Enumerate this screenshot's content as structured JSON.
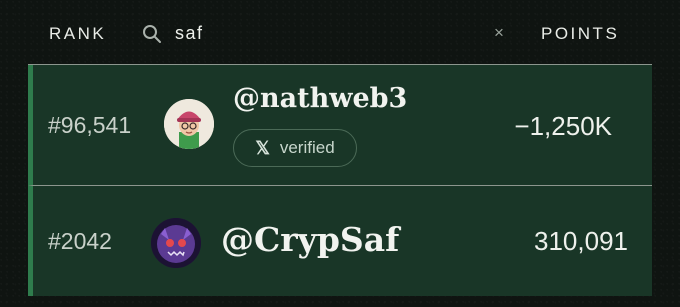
{
  "header": {
    "rank_label": "RANK",
    "search_value": "saf",
    "clear_symbol": "×",
    "points_label": "POINTS"
  },
  "rows": [
    {
      "rank": "#96,541",
      "handle": "@nathweb3",
      "badge": {
        "icon": "x-logo-icon",
        "symbol": "𝕏",
        "label": "verified"
      },
      "points": "−1,250K",
      "avatar": "avatar-pink-beanie"
    },
    {
      "rank": "#2042",
      "handle": "@CrypSaf",
      "points": "310,091",
      "avatar": "avatar-purple-creature"
    }
  ],
  "colors": {
    "background": "#0f1411",
    "row_fill": "#193627",
    "row_accent": "#2f7c4d",
    "divider": "#8c968e",
    "text": "#eef1ec"
  }
}
